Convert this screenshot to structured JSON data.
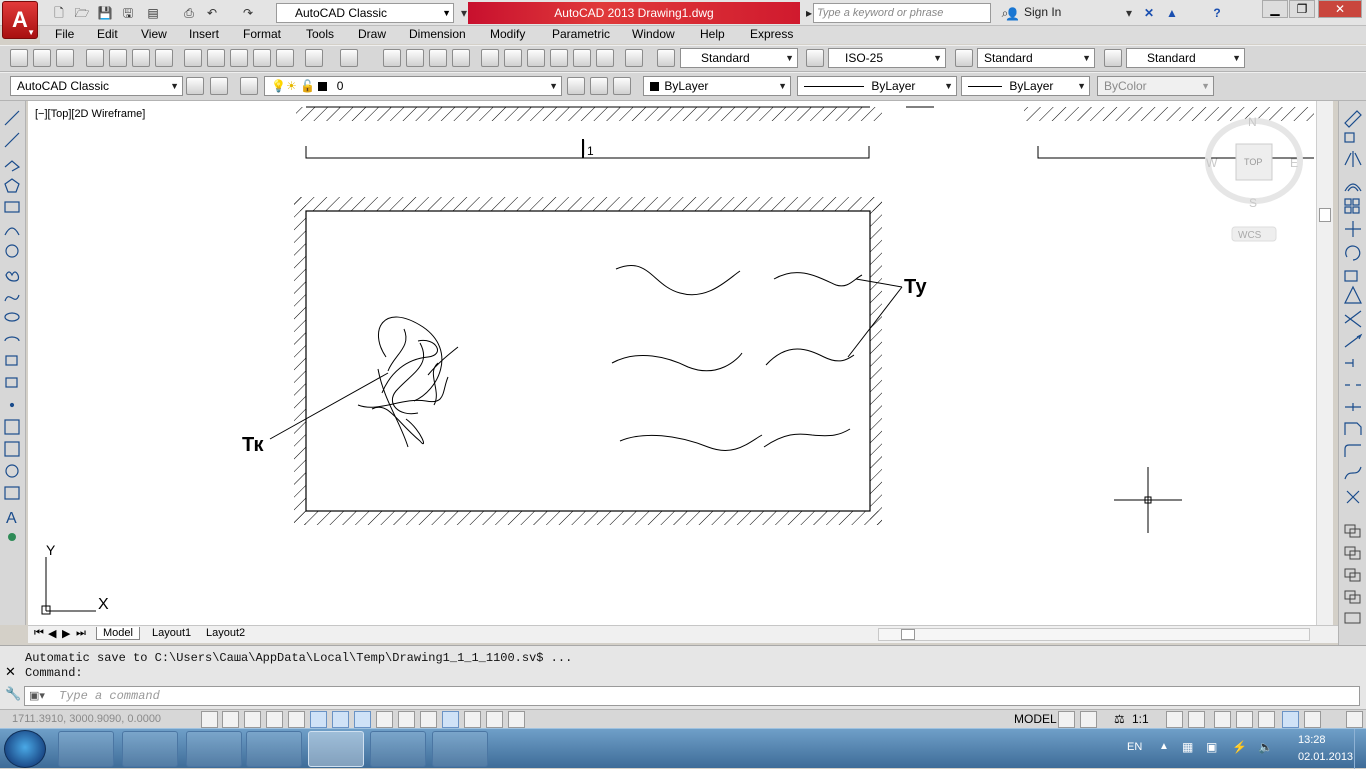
{
  "title_bar": {
    "workspace": "AutoCAD Classic",
    "app_title": "AutoCAD 2013    Drawing1.dwg",
    "search_placeholder": "Type a keyword or phrase",
    "sign_in": "Sign In"
  },
  "menu": [
    "File",
    "Edit",
    "View",
    "Insert",
    "Format",
    "Tools",
    "Draw",
    "Dimension",
    "Modify",
    "Parametric",
    "Window",
    "Help",
    "Express"
  ],
  "styles_toolbar": {
    "text_style": "Standard",
    "dim_style": "ISO-25",
    "table_style": "Standard",
    "multileader_style": "Standard"
  },
  "layers_toolbar": {
    "workspace": "AutoCAD Classic",
    "layer": "0",
    "color": "ByLayer",
    "linetype": "ByLayer",
    "lineweight": "ByLayer",
    "plot_style": "ByColor"
  },
  "viewport_label": "[−][Top][2D Wireframe]",
  "viewcube": {
    "north": "N",
    "south": "S",
    "east": "E",
    "west": "W",
    "face": "TOP",
    "wcs": "WCS"
  },
  "drawing": {
    "dimension_label": "l",
    "dimension_subscript": "1",
    "label_tk": "Тк",
    "label_ty": "Ту"
  },
  "ucs": {
    "x": "X",
    "y": "Y"
  },
  "tabs": [
    "Model",
    "Layout1",
    "Layout2"
  ],
  "command": {
    "history": [
      "Automatic save to C:\\Users\\Саша\\AppData\\Local\\Temp\\Drawing1_1_1_1100.sv$ ...",
      "Command:"
    ],
    "placeholder": "Type a command"
  },
  "status": {
    "coordinates": "1711.3910, 3000.9090, 0.0000",
    "model": "MODEL",
    "annotation_scale": "1:1"
  },
  "taskbar": {
    "language": "EN",
    "time": "13:28",
    "date": "02.01.2013"
  }
}
